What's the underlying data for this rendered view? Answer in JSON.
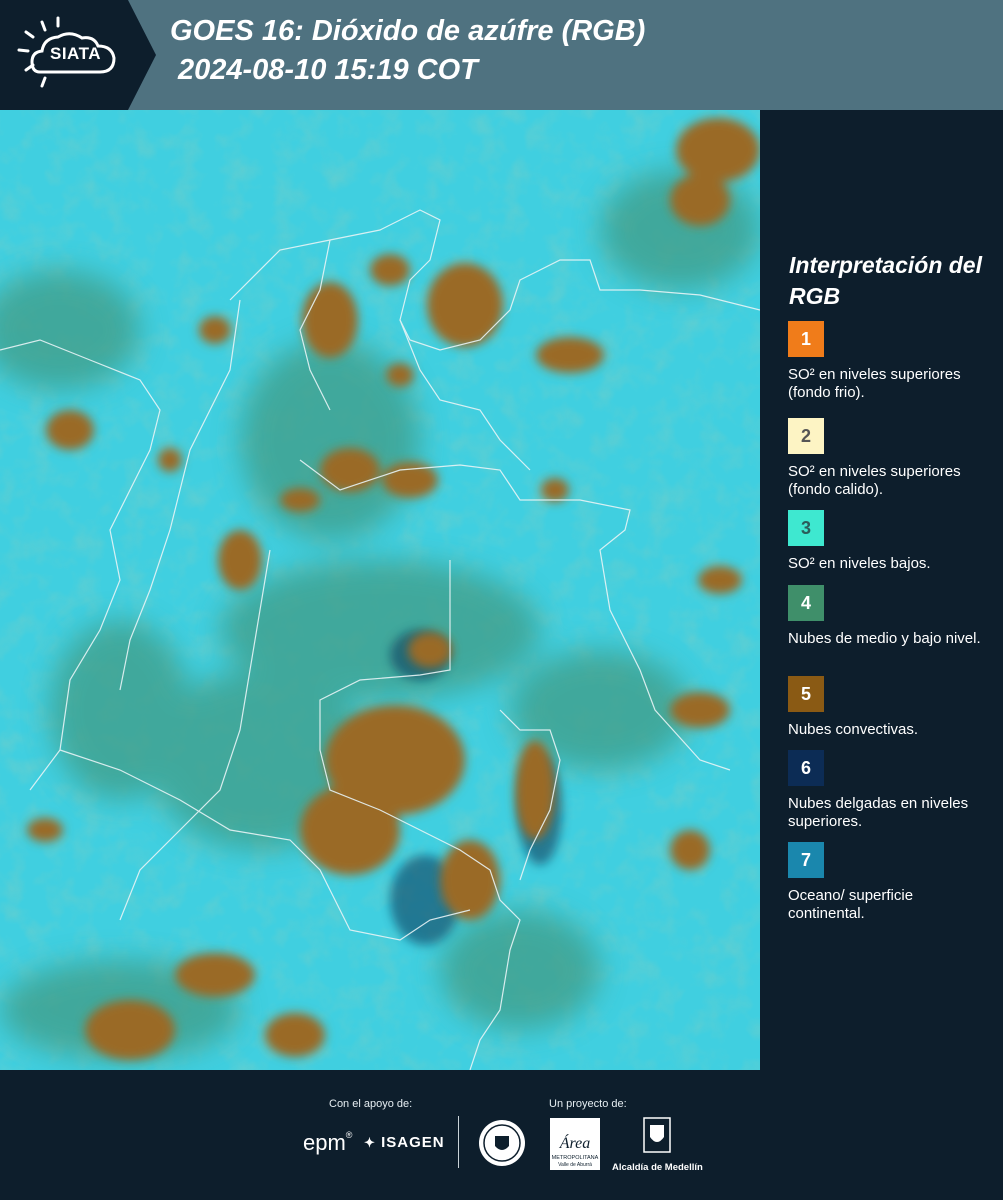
{
  "header": {
    "logo_text": "SIATA",
    "title_line1": "GOES 16: Dióxido de azúfre (RGB)",
    "title_line2": "2024-08-10 15:19 COT"
  },
  "legend": {
    "title": "Interpretación del RGB",
    "items": [
      {
        "number": "1",
        "color": "#f07c1a",
        "text_color": "#ffffff",
        "description": "SO² en niveles superiores (fondo frio)."
      },
      {
        "number": "2",
        "color": "#fdf4c4",
        "text_color": "#555555",
        "description": "SO² en niveles superiores (fondo calido)."
      },
      {
        "number": "3",
        "color": "#3ee8d0",
        "text_color": "#2b5c5a",
        "description": "SO² en niveles bajos."
      },
      {
        "number": "4",
        "color": "#3f8f6a",
        "text_color": "#ffffff",
        "description": "Nubes de medio y bajo nivel."
      },
      {
        "number": "5",
        "color": "#8a5a14",
        "text_color": "#ffffff",
        "description": "Nubes convectivas."
      },
      {
        "number": "6",
        "color": "#0c2c55",
        "text_color": "#ffffff",
        "description": "Nubes delgadas en niveles superiores."
      },
      {
        "number": "7",
        "color": "#1a87ad",
        "text_color": "#ffffff",
        "description": "Oceano/ superficie continental."
      }
    ]
  },
  "footer": {
    "support_label": "Con el apoyo de:",
    "project_label": "Un proyecto de:",
    "epm": "epm",
    "isagen": "ISAGEN",
    "area_text": "Área",
    "area_sub": "METROPOLITANA",
    "area_sub2": "Valle de Aburrá",
    "alcaldia": "Alcaldía de Medellín"
  },
  "colors": {
    "header_bg": "#4f7280",
    "panel_bg": "#0d1e2c",
    "map_cyan": "#40cfe0",
    "map_green": "#3f9c86",
    "map_convective": "#9a6b28"
  }
}
